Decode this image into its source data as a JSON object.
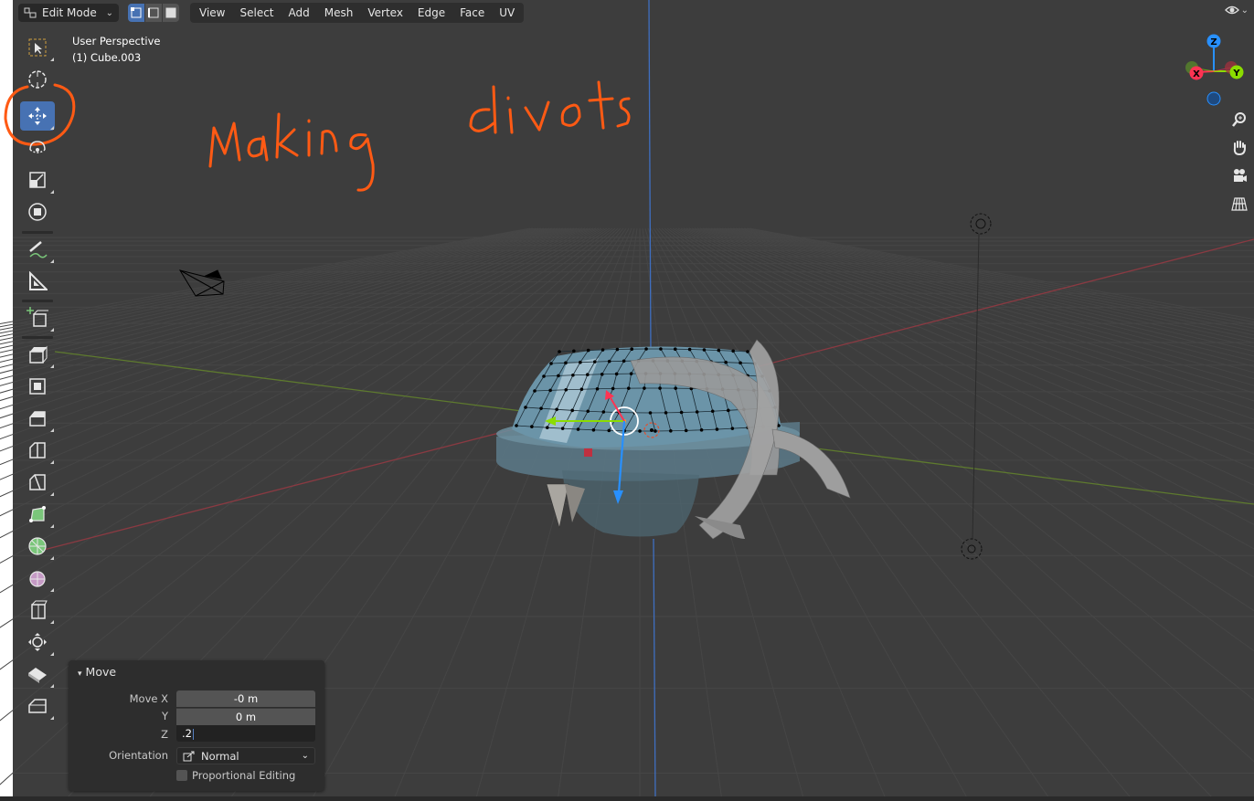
{
  "header": {
    "mode": "Edit Mode",
    "menus": [
      "View",
      "Select",
      "Add",
      "Mesh",
      "Vertex",
      "Edge",
      "Face",
      "UV"
    ]
  },
  "viewport": {
    "view_name": "User Perspective",
    "object_name": "(1) Cube.003"
  },
  "annotation": {
    "text": "Making divots",
    "color": "#ff5a14"
  },
  "toolbar": {
    "tools": [
      "select-box",
      "cursor",
      "move",
      "rotate",
      "scale",
      "transform",
      "annotate",
      "measure",
      "add-cube",
      "extrude-region",
      "inset-faces",
      "bevel",
      "loop-cut",
      "knife",
      "poly-build",
      "spin",
      "smooth",
      "edge-slide",
      "shrink-fatten",
      "shear",
      "rip-region"
    ],
    "active": "move",
    "accent": "#4772b3"
  },
  "gizmo": {
    "x_label": "X",
    "y_label": "Y",
    "z_label": "Z",
    "x_color": "#ff3352",
    "y_color": "#8bdc00",
    "z_color": "#2890ff"
  },
  "operator_panel": {
    "title": "Move",
    "move_x_label": "Move X",
    "move_x_value": "-0 m",
    "y_label": "Y",
    "y_value": "0 m",
    "z_label": "Z",
    "z_value": ".2",
    "orientation_label": "Orientation",
    "orientation_value": "Normal",
    "proportional_label": "Proportional Editing"
  }
}
